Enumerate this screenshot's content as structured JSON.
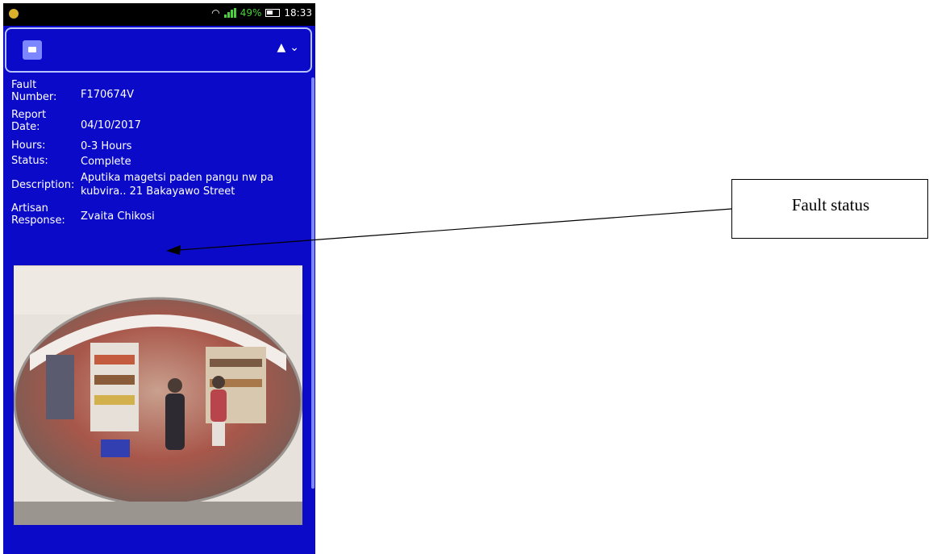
{
  "status_bar": {
    "battery_percent": "49%",
    "time": "18:33"
  },
  "header": {
    "menu_icon": "menu-icon",
    "user_icon": "user-icon",
    "user_caret_icon": "chevron-down-icon"
  },
  "fault": {
    "fault_number_label": "Fault\nNumber:",
    "fault_number": "F170674V",
    "report_date_label": "Report\nDate:",
    "report_date": "04/10/2017",
    "hours_label": "Hours:",
    "hours": "0-3 Hours",
    "status_label": "Status:",
    "status": "Complete",
    "description_label": "Description:",
    "description": "Aputika magetsi paden pangu nw pa kubvira.. 21 Bakayawo Street",
    "artisan_label": "Artisan\nResponse:",
    "artisan_response": "Zvaita Chikosi"
  },
  "annotation": {
    "callout_text": "Fault status"
  },
  "colors": {
    "screen_background": "#0a0ac8",
    "header_border": "#b7c3ff",
    "menu_button": "#7c86ff",
    "signal_green": "#4ad03a"
  }
}
